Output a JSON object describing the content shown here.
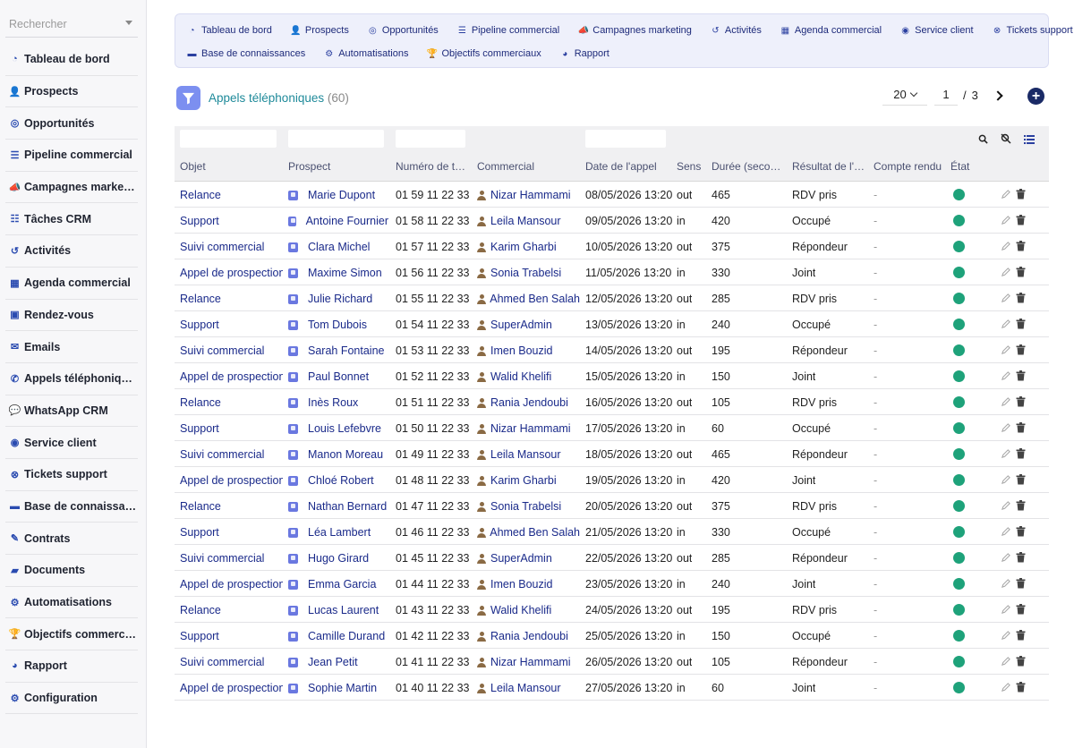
{
  "sidebar": {
    "search_placeholder": "Rechercher",
    "items": [
      {
        "label": "Tableau de bord",
        "icon": "dashboard-icon",
        "glyph": "◔"
      },
      {
        "label": "Prospects",
        "icon": "user-plus-icon",
        "glyph": "👤"
      },
      {
        "label": "Opportunités",
        "icon": "target-icon",
        "glyph": "◎"
      },
      {
        "label": "Pipeline commercial",
        "icon": "bars-icon",
        "glyph": "☰"
      },
      {
        "label": "Campagnes marketing",
        "icon": "megaphone-icon",
        "glyph": "📣"
      },
      {
        "label": "Tâches CRM",
        "icon": "list-icon",
        "glyph": "☷"
      },
      {
        "label": "Activités",
        "icon": "history-icon",
        "glyph": "↺"
      },
      {
        "label": "Agenda commercial",
        "icon": "calendar-icon",
        "glyph": "▦"
      },
      {
        "label": "Rendez-vous",
        "icon": "calendar-check-icon",
        "glyph": "▣"
      },
      {
        "label": "Emails",
        "icon": "envelope-icon",
        "glyph": "✉"
      },
      {
        "label": "Appels téléphoniques",
        "icon": "phone-icon",
        "glyph": "✆"
      },
      {
        "label": "WhatsApp CRM",
        "icon": "chat-icon",
        "glyph": "💬"
      },
      {
        "label": "Service client",
        "icon": "headset-icon",
        "glyph": "◉"
      },
      {
        "label": "Tickets support",
        "icon": "ticket-x-icon",
        "glyph": "⊗"
      },
      {
        "label": "Base de connaissan…",
        "icon": "book-icon",
        "glyph": "▬"
      },
      {
        "label": "Contrats",
        "icon": "contract-icon",
        "glyph": "✎"
      },
      {
        "label": "Documents",
        "icon": "folder-icon",
        "glyph": "▰"
      },
      {
        "label": "Automatisations",
        "icon": "robot-icon",
        "glyph": "⚙"
      },
      {
        "label": "Objectifs commerciaux",
        "icon": "trophy-icon",
        "glyph": "🏆"
      },
      {
        "label": "Rapport",
        "icon": "pie-chart-icon",
        "glyph": "◕"
      },
      {
        "label": "Configuration",
        "icon": "gear-icon",
        "glyph": "⚙"
      }
    ]
  },
  "topnav": {
    "row1": [
      {
        "label": "Tableau de bord",
        "icon": "dashboard-icon",
        "glyph": "◔"
      },
      {
        "label": "Prospects",
        "icon": "user-plus-icon",
        "glyph": "👤"
      },
      {
        "label": "Opportunités",
        "icon": "target-icon",
        "glyph": "◎"
      },
      {
        "label": "Pipeline commercial",
        "icon": "bars-icon",
        "glyph": "☰"
      },
      {
        "label": "Campagnes marketing",
        "icon": "megaphone-icon",
        "glyph": "📣"
      },
      {
        "label": "Activités",
        "icon": "history-icon",
        "glyph": "↺"
      },
      {
        "label": "Agenda commercial",
        "icon": "calendar-icon",
        "glyph": "▦"
      },
      {
        "label": "Service client",
        "icon": "headset-icon",
        "glyph": "◉"
      },
      {
        "label": "Tickets support",
        "icon": "ticket-x-icon",
        "glyph": "⊗"
      }
    ],
    "row2": [
      {
        "label": "Base de connaissances",
        "icon": "book-icon",
        "glyph": "▬"
      },
      {
        "label": "Automatisations",
        "icon": "robot-icon",
        "glyph": "⚙"
      },
      {
        "label": "Objectifs commerciaux",
        "icon": "trophy-icon",
        "glyph": "🏆"
      },
      {
        "label": "Rapport",
        "icon": "pie-chart-icon",
        "glyph": "◕"
      }
    ]
  },
  "page": {
    "title": "Appels téléphoniques",
    "count": "(60)"
  },
  "pager": {
    "per_page": "20",
    "current_page": "1",
    "separator": "/",
    "total_pages": "3"
  },
  "table": {
    "columns": [
      "Objet",
      "Prospect",
      "Numéro de t…",
      "Commercial",
      "Date de l'appel",
      "Sens",
      "Durée (seco…",
      "Résultat de l'…",
      "Compte rendu",
      "État"
    ],
    "rows": [
      {
        "objet": "Relance",
        "prospect": "Marie Dupont",
        "numero": "01 59 11 22 33",
        "commercial": "Nizar Hammami",
        "date": "08/05/2026 13:20",
        "sens": "out",
        "duree": "465",
        "resultat": "RDV pris",
        "compte_rendu": "-"
      },
      {
        "objet": "Support",
        "prospect": "Antoine Fournier",
        "numero": "01 58 11 22 33",
        "commercial": "Leila Mansour",
        "date": "09/05/2026 13:20",
        "sens": "in",
        "duree": "420",
        "resultat": "Occupé",
        "compte_rendu": "-"
      },
      {
        "objet": "Suivi commercial",
        "prospect": "Clara Michel",
        "numero": "01 57 11 22 33",
        "commercial": "Karim Gharbi",
        "date": "10/05/2026 13:20",
        "sens": "out",
        "duree": "375",
        "resultat": "Répondeur",
        "compte_rendu": "-"
      },
      {
        "objet": "Appel de prospection",
        "prospect": "Maxime Simon",
        "numero": "01 56 11 22 33",
        "commercial": "Sonia Trabelsi",
        "date": "11/05/2026 13:20",
        "sens": "in",
        "duree": "330",
        "resultat": "Joint",
        "compte_rendu": "-"
      },
      {
        "objet": "Relance",
        "prospect": "Julie Richard",
        "numero": "01 55 11 22 33",
        "commercial": "Ahmed Ben Salah",
        "date": "12/05/2026 13:20",
        "sens": "out",
        "duree": "285",
        "resultat": "RDV pris",
        "compte_rendu": "-"
      },
      {
        "objet": "Support",
        "prospect": "Tom Dubois",
        "numero": "01 54 11 22 33",
        "commercial": "SuperAdmin",
        "date": "13/05/2026 13:20",
        "sens": "in",
        "duree": "240",
        "resultat": "Occupé",
        "compte_rendu": "-"
      },
      {
        "objet": "Suivi commercial",
        "prospect": "Sarah Fontaine",
        "numero": "01 53 11 22 33",
        "commercial": "Imen Bouzid",
        "date": "14/05/2026 13:20",
        "sens": "out",
        "duree": "195",
        "resultat": "Répondeur",
        "compte_rendu": "-"
      },
      {
        "objet": "Appel de prospection",
        "prospect": "Paul Bonnet",
        "numero": "01 52 11 22 33",
        "commercial": "Walid Khelifi",
        "date": "15/05/2026 13:20",
        "sens": "in",
        "duree": "150",
        "resultat": "Joint",
        "compte_rendu": "-"
      },
      {
        "objet": "Relance",
        "prospect": "Inès Roux",
        "numero": "01 51 11 22 33",
        "commercial": "Rania Jendoubi",
        "date": "16/05/2026 13:20",
        "sens": "out",
        "duree": "105",
        "resultat": "RDV pris",
        "compte_rendu": "-"
      },
      {
        "objet": "Support",
        "prospect": "Louis Lefebvre",
        "numero": "01 50 11 22 33",
        "commercial": "Nizar Hammami",
        "date": "17/05/2026 13:20",
        "sens": "in",
        "duree": "60",
        "resultat": "Occupé",
        "compte_rendu": "-"
      },
      {
        "objet": "Suivi commercial",
        "prospect": "Manon Moreau",
        "numero": "01 49 11 22 33",
        "commercial": "Leila Mansour",
        "date": "18/05/2026 13:20",
        "sens": "out",
        "duree": "465",
        "resultat": "Répondeur",
        "compte_rendu": "-"
      },
      {
        "objet": "Appel de prospection",
        "prospect": "Chloé Robert",
        "numero": "01 48 11 22 33",
        "commercial": "Karim Gharbi",
        "date": "19/05/2026 13:20",
        "sens": "in",
        "duree": "420",
        "resultat": "Joint",
        "compte_rendu": "-"
      },
      {
        "objet": "Relance",
        "prospect": "Nathan Bernard",
        "numero": "01 47 11 22 33",
        "commercial": "Sonia Trabelsi",
        "date": "20/05/2026 13:20",
        "sens": "out",
        "duree": "375",
        "resultat": "RDV pris",
        "compte_rendu": "-"
      },
      {
        "objet": "Support",
        "prospect": "Léa Lambert",
        "numero": "01 46 11 22 33",
        "commercial": "Ahmed Ben Salah",
        "date": "21/05/2026 13:20",
        "sens": "in",
        "duree": "330",
        "resultat": "Occupé",
        "compte_rendu": "-"
      },
      {
        "objet": "Suivi commercial",
        "prospect": "Hugo Girard",
        "numero": "01 45 11 22 33",
        "commercial": "SuperAdmin",
        "date": "22/05/2026 13:20",
        "sens": "out",
        "duree": "285",
        "resultat": "Répondeur",
        "compte_rendu": "-"
      },
      {
        "objet": "Appel de prospection",
        "prospect": "Emma Garcia",
        "numero": "01 44 11 22 33",
        "commercial": "Imen Bouzid",
        "date": "23/05/2026 13:20",
        "sens": "in",
        "duree": "240",
        "resultat": "Joint",
        "compte_rendu": "-"
      },
      {
        "objet": "Relance",
        "prospect": "Lucas Laurent",
        "numero": "01 43 11 22 33",
        "commercial": "Walid Khelifi",
        "date": "24/05/2026 13:20",
        "sens": "out",
        "duree": "195",
        "resultat": "RDV pris",
        "compte_rendu": "-"
      },
      {
        "objet": "Support",
        "prospect": "Camille Durand",
        "numero": "01 42 11 22 33",
        "commercial": "Rania Jendoubi",
        "date": "25/05/2026 13:20",
        "sens": "in",
        "duree": "150",
        "resultat": "Occupé",
        "compte_rendu": "-"
      },
      {
        "objet": "Suivi commercial",
        "prospect": "Jean Petit",
        "numero": "01 41 11 22 33",
        "commercial": "Nizar Hammami",
        "date": "26/05/2026 13:20",
        "sens": "out",
        "duree": "105",
        "resultat": "Répondeur",
        "compte_rendu": "-"
      },
      {
        "objet": "Appel de prospection",
        "prospect": "Sophie Martin",
        "numero": "01 40 11 22 33",
        "commercial": "Leila Mansour",
        "date": "27/05/2026 13:20",
        "sens": "in",
        "duree": "60",
        "resultat": "Joint",
        "compte_rendu": "-"
      }
    ]
  },
  "colors": {
    "status_dot": "#1ea27a",
    "link": "#1a2a8a",
    "title": "#1f8a9a",
    "nav_bg": "#eef0fb",
    "add_button": "#1a2a66"
  }
}
